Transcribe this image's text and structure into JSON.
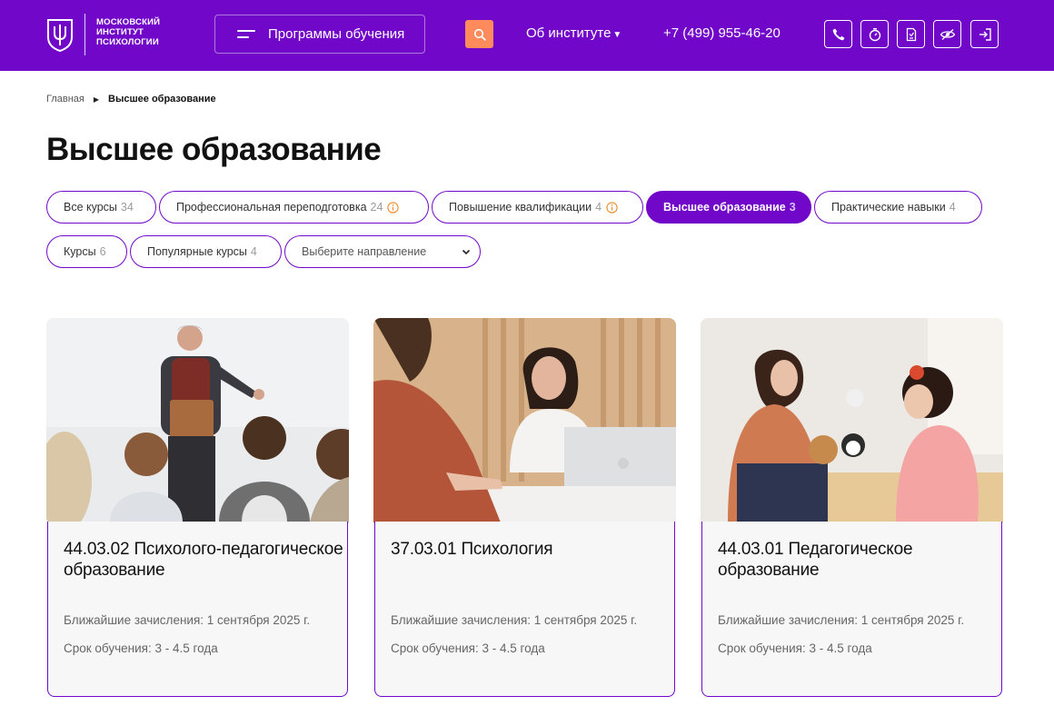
{
  "brand": {
    "logo_lines": [
      "МОСКОВСКИЙ",
      "ИНСТИТУТ",
      "ПСИХОЛОГИИ"
    ]
  },
  "header": {
    "programs_label": "Программы обучения",
    "about_label": "Об институте",
    "phone": "+7 (499) 955-46-20",
    "icons": [
      "phone-icon",
      "stopwatch-icon",
      "document-icon",
      "eye-off-icon",
      "login-icon"
    ]
  },
  "breadcrumb": {
    "home": "Главная",
    "current": "Высшее образование"
  },
  "page": {
    "title": "Высшее образование"
  },
  "filters": [
    {
      "label": "Все курсы",
      "count": "34",
      "info": false,
      "active": false
    },
    {
      "label": "Профессиональная переподготовка",
      "count": "24",
      "info": true,
      "active": false
    },
    {
      "label": "Повышение квалификации",
      "count": "4",
      "info": true,
      "active": false
    },
    {
      "label": "Высшее образование",
      "count": "3",
      "info": false,
      "active": true
    },
    {
      "label": "Практические навыки",
      "count": "4",
      "info": false,
      "active": false
    },
    {
      "label": "Курсы",
      "count": "6",
      "info": false,
      "active": false
    },
    {
      "label": "Популярные курсы",
      "count": "4",
      "info": false,
      "active": false
    }
  ],
  "direction_select": {
    "placeholder": "Выберите направление"
  },
  "cards": [
    {
      "title": "44.03.02 Психолого-педагогическое образование",
      "enrollment": "Ближайшие зачисления: 1 сентября 2025 г.",
      "duration": "Срок обучения: 3 - 4.5 года"
    },
    {
      "title": "37.03.01 Психология",
      "enrollment": "Ближайшие зачисления: 1 сентября 2025 г.",
      "duration": "Срок обучения: 3 - 4.5 года"
    },
    {
      "title": "44.03.01 Педагогическое образование",
      "enrollment": "Ближайшие зачисления: 1 сентября 2025 г.",
      "duration": "Срок обучения: 3 - 4.5 года"
    }
  ],
  "colors": {
    "brand_purple": "#7108c9",
    "search_orange": "#ff8a5b",
    "info_orange": "#f08a24",
    "card_bg": "#f7f7f7"
  }
}
